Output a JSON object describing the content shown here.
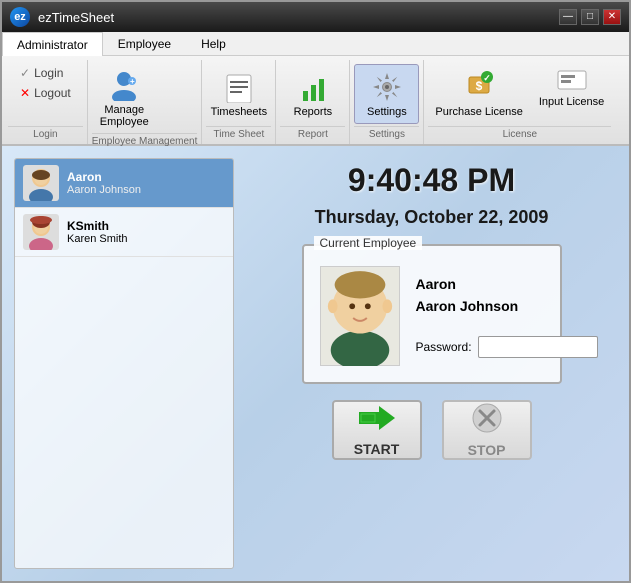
{
  "window": {
    "title": "ezTimeSheet",
    "icon": "ez"
  },
  "titlebar": {
    "minimize": "—",
    "maximize": "□",
    "close": "✕"
  },
  "menubar": {
    "tabs": [
      {
        "id": "administrator",
        "label": "Administrator",
        "active": true
      },
      {
        "id": "employee",
        "label": "Employee",
        "active": false
      },
      {
        "id": "help",
        "label": "Help",
        "active": false
      }
    ]
  },
  "toolbar": {
    "login_section_label": "Login",
    "login_btn": "Login",
    "logout_btn": "Logout",
    "employee_management_section_label": "Employee Management",
    "manage_employee_btn": "Manage Employee",
    "timesheet_section_label": "Time Sheet",
    "timesheets_btn": "Timesheets",
    "report_section_label": "Report",
    "reports_btn": "Reports",
    "settings_section_label": "Settings",
    "settings_btn": "Settings",
    "license_section_label": "License",
    "purchase_license_btn": "Purchase License",
    "input_license_btn": "Input License"
  },
  "employees": [
    {
      "id": "aaron",
      "username": "Aaron",
      "fullname": "Aaron Johnson",
      "gender": "male",
      "selected": true
    },
    {
      "id": "ksmith",
      "username": "KSmith",
      "fullname": "Karen Smith",
      "gender": "female",
      "selected": false
    }
  ],
  "clock": {
    "time": "9:40:48 PM",
    "date": "Thursday, October 22, 2009"
  },
  "current_employee": {
    "label": "Current Employee",
    "firstname": "Aaron",
    "lastname": "Aaron Johnson",
    "password_label": "Password:",
    "password_placeholder": ""
  },
  "actions": {
    "start_label": "START",
    "stop_label": "STOP"
  }
}
